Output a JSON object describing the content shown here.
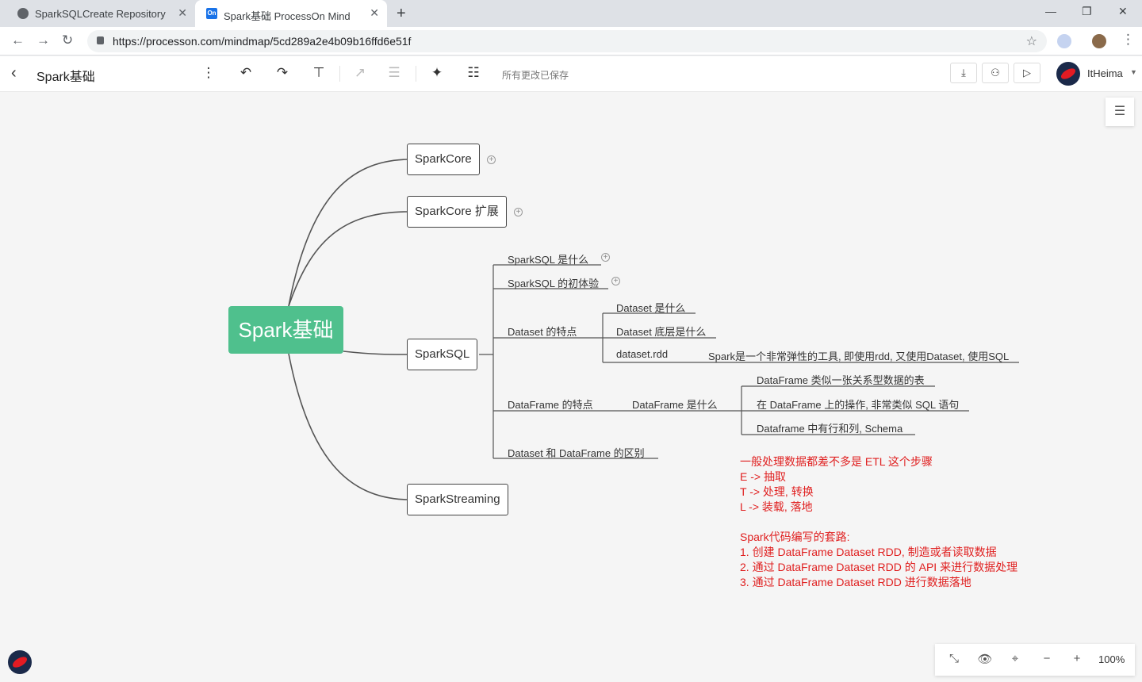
{
  "browser": {
    "tabs": [
      {
        "title": "SparkSQLCreate Repository",
        "active": false
      },
      {
        "title": "Spark基础 ProcessOn Mind",
        "active": true
      }
    ],
    "favicon_on": "On",
    "url": "https://processon.com/mindmap/5cd289a2e4b09b16ffd6e51f"
  },
  "app": {
    "doc_title": "Spark基础",
    "save_status": "所有更改已保存",
    "username": "ItHeima",
    "zoom": "100%"
  },
  "mindmap": {
    "root": "Spark基础",
    "branches": {
      "sparkcore": "SparkCore",
      "sparkcore_ext": "SparkCore 扩展",
      "sparksql": "SparkSQL",
      "sparkstreaming": "SparkStreaming"
    },
    "sql": {
      "what": "SparkSQL 是什么",
      "first": "SparkSQL 的初体验",
      "dataset_feat": "Dataset 的特点",
      "ds_what": "Dataset 是什么",
      "ds_bottom": "Dataset 底层是什么",
      "ds_rdd": "dataset.rdd",
      "ds_rdd_note": "Spark是一个非常弹性的工具, 即使用rdd, 又使用Dataset, 使用SQL",
      "df_feat": "DataFrame 的特点",
      "df_what": "DataFrame 是什么",
      "df_1": "DataFrame 类似一张关系型数据的表",
      "df_2": "在 DataFrame 上的操作, 非常类似 SQL 语句",
      "df_3": "Dataframe 中有行和列, Schema",
      "diff": "Dataset 和 DataFrame 的区别"
    },
    "note": "一般处理数据都差不多是 ETL 这个步骤\nE -> 抽取\nT -> 处理, 转换\nL -> 装载, 落地\n\nSpark代码编写的套路:\n1. 创建 DataFrame Dataset RDD, 制造或者读取数据\n2. 通过 DataFrame Dataset RDD 的 API 来进行数据处理\n3. 通过 DataFrame Dataset RDD 进行数据落地"
  }
}
